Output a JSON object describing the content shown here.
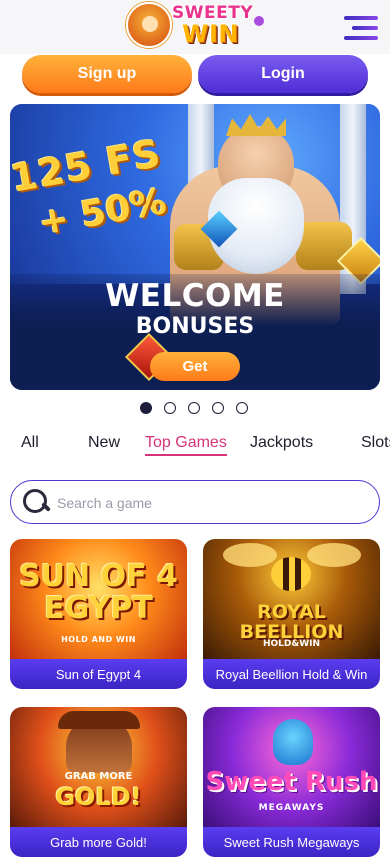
{
  "header": {
    "logo": {
      "line1": "SWEETY",
      "line2": "WIN"
    },
    "menu_icon": "hamburger-menu-icon"
  },
  "auth": {
    "signup_label": "Sign up",
    "login_label": "Login"
  },
  "banner": {
    "promo_line1": "125 FS",
    "promo_line2": "+ 50%",
    "title": "WELCOME",
    "subtitle": "BONUSES",
    "cta_label": "Get"
  },
  "carousel": {
    "total": 5,
    "active_index": 0
  },
  "tabs": [
    {
      "label": "All",
      "active": false
    },
    {
      "label": "New",
      "active": false
    },
    {
      "label": "Top Games",
      "active": true
    },
    {
      "label": "Jackpots",
      "active": false
    },
    {
      "label": "Slots",
      "active": false
    }
  ],
  "search": {
    "placeholder": "Search a game",
    "value": ""
  },
  "games": [
    {
      "name": "Sun of Egypt 4",
      "art_title": "SUN OF 4 EGYPT",
      "art_sub": "HOLD AND WIN"
    },
    {
      "name": "Royal Beellion Hold & Win",
      "art_title": "ROYAL BEELLION",
      "art_sub": "HOLD&WIN"
    },
    {
      "name": "Grab more Gold!",
      "art_title": "GOLD!",
      "art_sub": "GRAB MORE"
    },
    {
      "name": "Sweet Rush Megaways",
      "art_title": "Sweet Rush",
      "art_sub": "MEGAWAYS"
    }
  ],
  "colors": {
    "primary_purple": "#4e2dd6",
    "accent_orange": "#ff7a1a",
    "active_tab": "#d6337a",
    "banner_dark": "#0d1e52"
  }
}
